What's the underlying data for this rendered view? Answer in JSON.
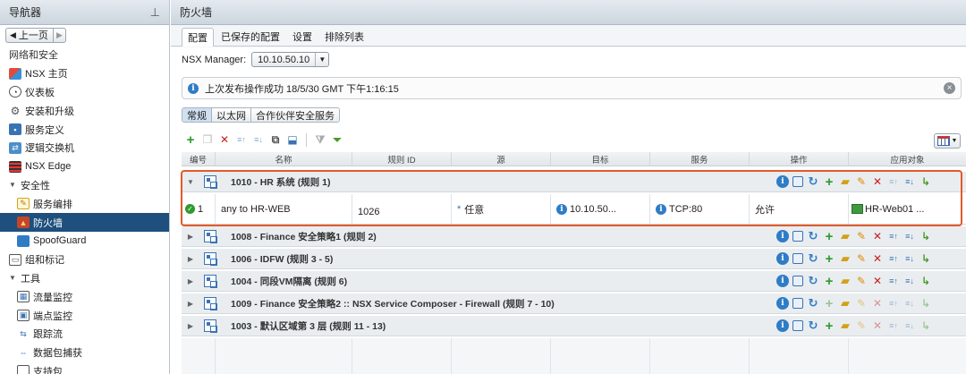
{
  "navigator": {
    "title": "导航器",
    "back_label": "上一页",
    "items": [
      {
        "label": "网络和安全",
        "kind": "section"
      },
      {
        "label": "NSX 主页",
        "icon": "nsx-home-icon"
      },
      {
        "label": "仪表板",
        "icon": "dashboard-icon"
      },
      {
        "label": "安装和升级",
        "icon": "gear-icon"
      },
      {
        "label": "服务定义",
        "icon": "service-definition-icon"
      },
      {
        "label": "逻辑交换机",
        "icon": "logical-switch-icon"
      },
      {
        "label": "NSX Edge",
        "icon": "edge-icon"
      },
      {
        "label": "安全性",
        "kind": "group"
      },
      {
        "label": "服务编排",
        "icon": "service-composer-icon"
      },
      {
        "label": "防火墙",
        "icon": "firewall-icon",
        "selected": true
      },
      {
        "label": "SpoofGuard",
        "icon": "spoofguard-icon"
      },
      {
        "label": "组和标记",
        "icon": "groups-tags-icon"
      },
      {
        "label": "工具",
        "kind": "group"
      },
      {
        "label": "流量监控",
        "icon": "flow-monitor-icon"
      },
      {
        "label": "端点监控",
        "icon": "endpoint-monitor-icon"
      },
      {
        "label": "跟踪流",
        "icon": "traceflow-icon"
      },
      {
        "label": "数据包捕获",
        "icon": "packet-capture-icon"
      },
      {
        "label": "支持包",
        "icon": "support-bundle-icon"
      }
    ]
  },
  "main": {
    "title": "防火墙",
    "tabs": [
      "配置",
      "已保存的配置",
      "设置",
      "排除列表"
    ],
    "manager_label": "NSX Manager:",
    "manager_value": "10.10.50.10",
    "info_message": "上次发布操作成功 18/5/30 GMT 下午1:16:15",
    "subtabs": [
      "常规",
      "以太网",
      "合作伙伴安全服务"
    ],
    "columns": [
      "编号",
      "名称",
      "规则 ID",
      "源",
      "目标",
      "服务",
      "操作",
      "应用对象"
    ],
    "sections": [
      "1010 - HR 系统 (规则 1)",
      "1008 - Finance 安全策略1 (规则 2)",
      "1006 - IDFW (规则 3 - 5)",
      "1004 - 同段VM隔离 (规则 6)",
      "1009 - Finance 安全策略2 :: NSX Service Composer - Firewall (规则 7 - 10)",
      "1003 - 默认区域第 3 层 (规则 11 - 13)"
    ],
    "rule": {
      "number": "1",
      "name": "any to HR-WEB",
      "rule_id": "1026",
      "source": "任意",
      "destination": "10.10.50...",
      "service": "TCP:80",
      "action": "允许",
      "applied_to": "HR-Web01 ..."
    }
  },
  "colors": {
    "highlight": "#e45a2a",
    "nav_selected": "#1f4f7d",
    "info_blue": "#2f7cc6"
  }
}
